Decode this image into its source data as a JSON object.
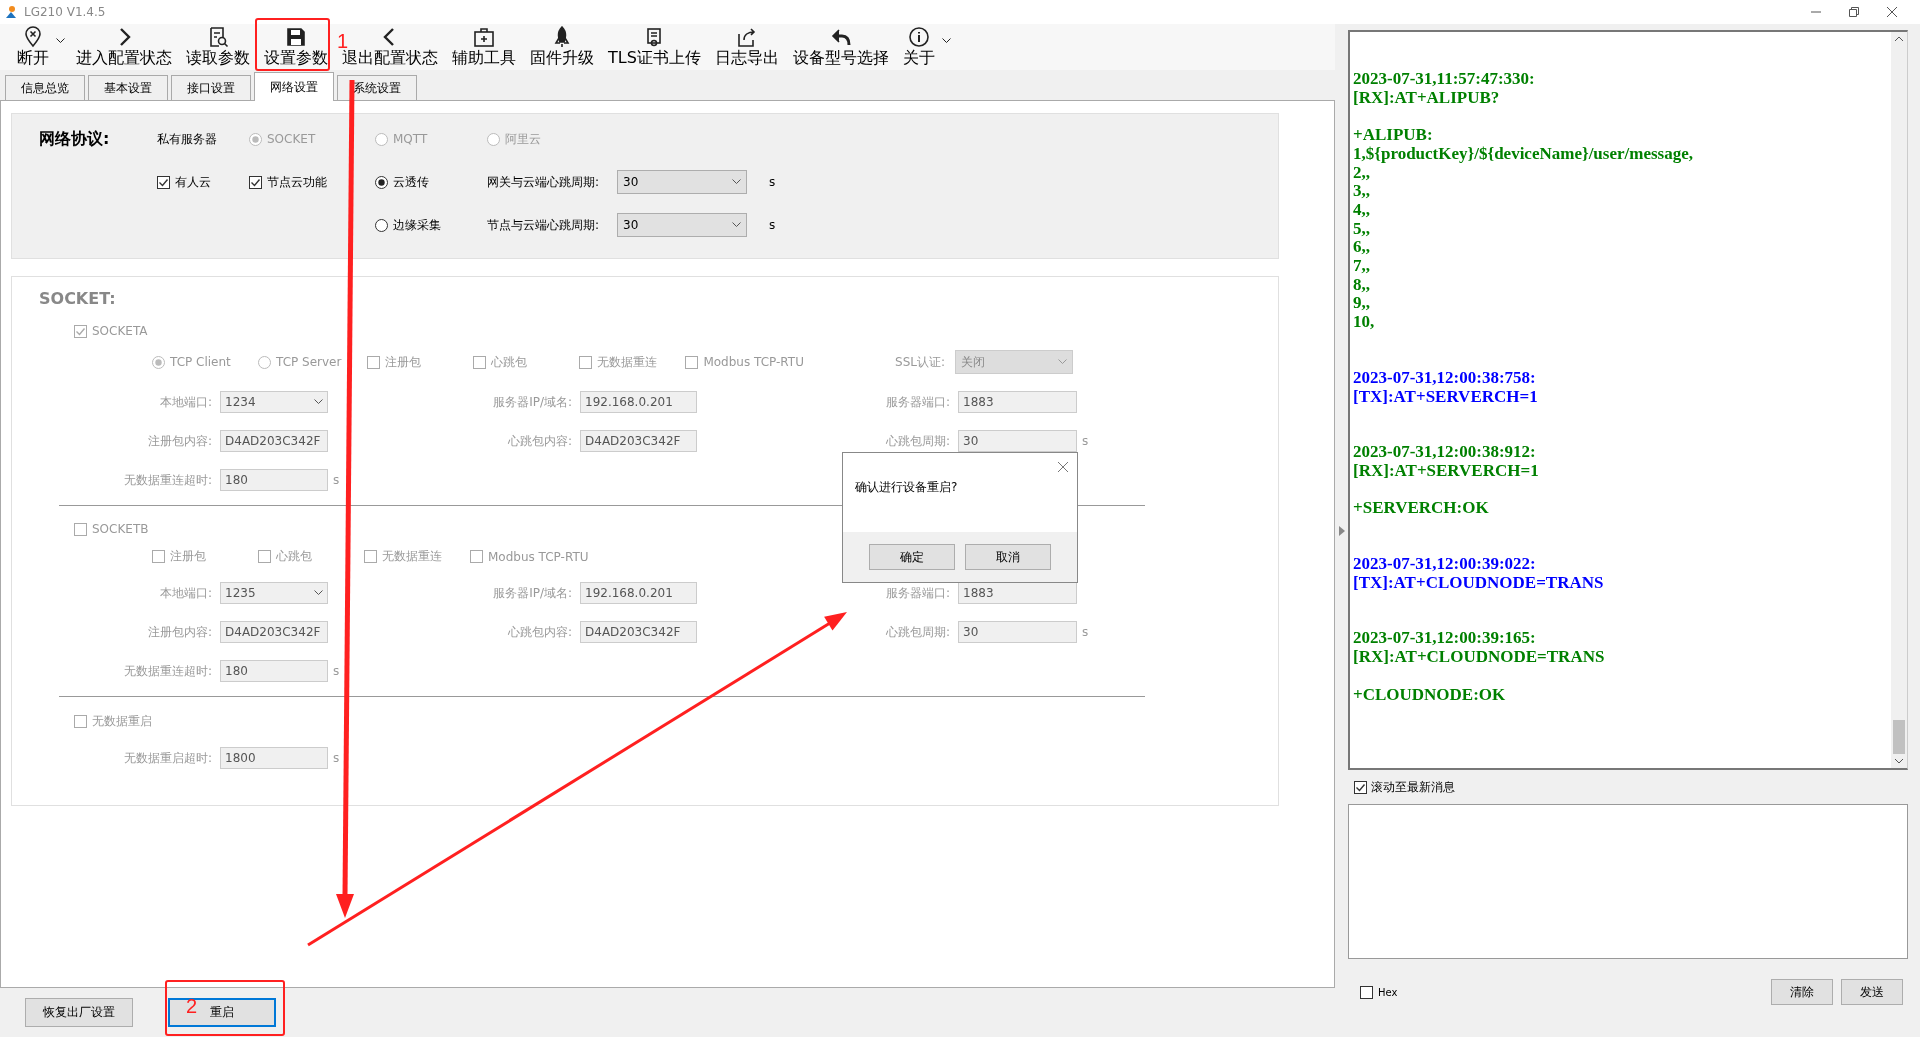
{
  "window": {
    "title": "LG210 V1.4.5"
  },
  "toolbar": [
    {
      "label": "断开",
      "has_menu": true
    },
    {
      "label": "进入配置状态",
      "has_menu": false
    },
    {
      "label": "读取参数",
      "has_menu": false
    },
    {
      "label": "设置参数",
      "has_menu": false
    },
    {
      "label": "退出配置状态",
      "has_menu": false
    },
    {
      "label": "辅助工具",
      "has_menu": false
    },
    {
      "label": "固件升级",
      "has_menu": false
    },
    {
      "label": "TLS证书上传",
      "has_menu": false
    },
    {
      "label": "日志导出",
      "has_menu": false
    },
    {
      "label": "设备型号选择",
      "has_menu": false
    },
    {
      "label": "关于",
      "has_menu": true
    }
  ],
  "tabs": [
    {
      "label": "信息总览",
      "selected": false
    },
    {
      "label": "基本设置",
      "selected": false
    },
    {
      "label": "接口设置",
      "selected": false
    },
    {
      "label": "网络设置",
      "selected": true
    },
    {
      "label": "系统设置",
      "selected": false
    }
  ],
  "network": {
    "title": "网络协议:",
    "server_label": "私有服务器",
    "protocols": [
      {
        "label": "SOCKET",
        "selected": true,
        "disabled": true
      },
      {
        "label": "MQTT",
        "selected": false,
        "disabled": true
      },
      {
        "label": "阿里云",
        "selected": false,
        "disabled": true
      }
    ],
    "clouds": [
      {
        "label": "有人云",
        "checked": true
      },
      {
        "label": "节点云功能",
        "checked": true
      }
    ],
    "modes": [
      {
        "label": "云透传",
        "selected": true,
        "field_label": "网关与云端心跳周期:",
        "value": "30",
        "unit": "s"
      },
      {
        "label": "边缘采集",
        "selected": false,
        "field_label": "节点与云端心跳周期:",
        "value": "30",
        "unit": "s"
      }
    ]
  },
  "socket": {
    "title": "SOCKET:",
    "sockets": [
      {
        "label": "SOCKETA",
        "checked": true,
        "options": [
          {
            "kind": "radio",
            "label": "TCP Client",
            "selected": true
          },
          {
            "kind": "radio",
            "label": "TCP Server",
            "selected": false
          },
          {
            "kind": "checkbox",
            "label": "注册包",
            "checked": false
          },
          {
            "kind": "checkbox",
            "label": "心跳包",
            "checked": false
          },
          {
            "kind": "checkbox",
            "label": "无数据重连",
            "checked": false
          },
          {
            "kind": "checkbox",
            "label": "Modbus TCP-RTU",
            "checked": false
          }
        ],
        "ssl": {
          "label": "SSL认证:",
          "value": "关闭"
        },
        "rows": [
          [
            {
              "label": "本地端口:",
              "value": "1234",
              "kind": "combo"
            },
            {
              "label": "服务器IP/域名:",
              "value": "192.168.0.201",
              "kind": "text"
            },
            {
              "label": "服务器端口:",
              "value": "1883",
              "kind": "text"
            }
          ],
          [
            {
              "label": "注册包内容:",
              "value": "D4AD203C342F",
              "kind": "text"
            },
            {
              "label": "心跳包内容:",
              "value": "D4AD203C342F",
              "kind": "text"
            },
            {
              "label": "心跳包周期:",
              "value": "30",
              "kind": "text",
              "unit": "s"
            }
          ],
          [
            {
              "label": "无数据重连超时:",
              "value": "180",
              "kind": "text",
              "unit": "s"
            }
          ]
        ]
      },
      {
        "label": "SOCKETB",
        "checked": false,
        "options": [
          {
            "kind": "checkbox",
            "label": "注册包",
            "checked": false
          },
          {
            "kind": "checkbox",
            "label": "心跳包",
            "checked": false
          },
          {
            "kind": "checkbox",
            "label": "无数据重连",
            "checked": false
          },
          {
            "kind": "checkbox",
            "label": "Modbus TCP-RTU",
            "checked": false
          }
        ],
        "rows": [
          [
            {
              "label": "本地端口:",
              "value": "1235",
              "kind": "combo"
            },
            {
              "label": "服务器IP/域名:",
              "value": "192.168.0.201",
              "kind": "text"
            },
            {
              "label": "服务器端口:",
              "value": "1883",
              "kind": "text"
            }
          ],
          [
            {
              "label": "注册包内容:",
              "value": "D4AD203C342F",
              "kind": "text"
            },
            {
              "label": "心跳包内容:",
              "value": "D4AD203C342F",
              "kind": "text"
            },
            {
              "label": "心跳包周期:",
              "value": "30",
              "kind": "text",
              "unit": "s"
            }
          ],
          [
            {
              "label": "无数据重连超时:",
              "value": "180",
              "kind": "text",
              "unit": "s"
            }
          ]
        ]
      }
    ],
    "restart": {
      "label": "无数据重启",
      "checked": false,
      "field": {
        "label": "无数据重启超时:",
        "value": "1800",
        "kind": "text",
        "unit": "s"
      }
    }
  },
  "bottom_buttons": [
    {
      "label": "恢复出厂设置",
      "focused": false
    },
    {
      "label": "重启",
      "focused": true
    }
  ],
  "dialog": {
    "message": "确认进行设备重启?",
    "buttons": [
      {
        "label": "确定"
      },
      {
        "label": "取消"
      }
    ]
  },
  "log": [
    {
      "color": "#008000",
      "text": "2023-07-31,11:57:47:330:\n[RX]:AT+ALIPUB?\n\n+ALIPUB:\n1,${productKey}/${deviceName}/user/message,\n2,,\n3,,\n4,,\n5,,\n6,,\n7,,\n8,,\n9,,\n10,"
    },
    {
      "color": "#0000ff",
      "text": "2023-07-31,12:00:38:758:\n[TX]:AT+SERVERCH=1"
    },
    {
      "color": "#008000",
      "text": "2023-07-31,12:00:38:912:\n[RX]:AT+SERVERCH=1\n\n+SERVERCH:OK"
    },
    {
      "color": "#0000ff",
      "text": "2023-07-31,12:00:39:022:\n[TX]:AT+CLOUDNODE=TRANS"
    },
    {
      "color": "#008000",
      "text": "2023-07-31,12:00:39:165:\n[RX]:AT+CLOUDNODE=TRANS\n\n+CLOUDNODE:OK"
    }
  ],
  "scroll_latest": {
    "label": "滚动至最新消息",
    "checked": true
  },
  "hex": {
    "label": "Hex",
    "checked": false
  },
  "send_buttons": [
    {
      "label": "清除"
    },
    {
      "label": "发送"
    }
  ],
  "annotations": [
    {
      "number": "1"
    },
    {
      "number": "2"
    }
  ]
}
